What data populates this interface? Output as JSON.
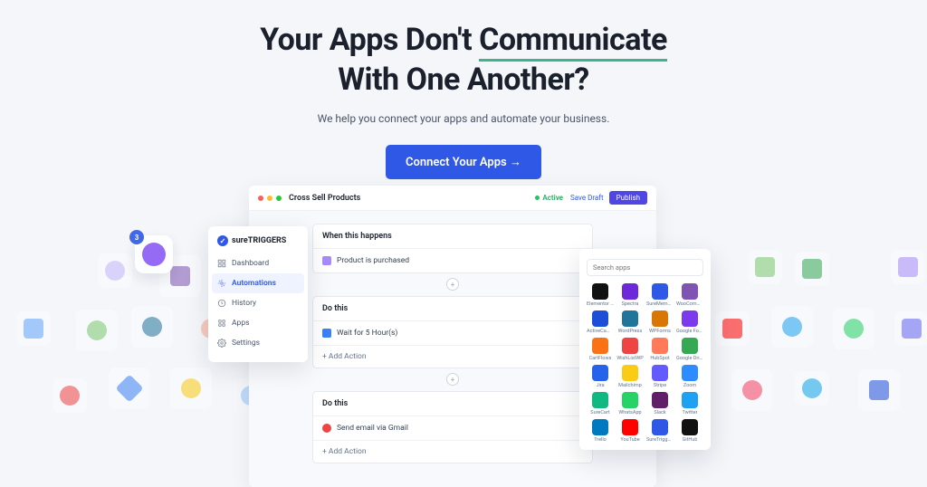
{
  "hero": {
    "headline_pre": "Your Apps Don't ",
    "headline_word": "Communicate",
    "headline_post": "With One Another?",
    "subhead": "We help you connect your apps and automate your business.",
    "cta": "Connect Your Apps →"
  },
  "builder": {
    "title": "Cross Sell Products",
    "status": "Active",
    "save_draft": "Save Draft",
    "publish": "Publish",
    "trigger_head": "When this happens",
    "trigger_row": "Product is purchased",
    "action1_head": "Do this",
    "action1_row": "Wait for 5 Hour(s)",
    "action2_head": "Do this",
    "action2_row": "Send email via Gmail",
    "add_action": "+   Add Action"
  },
  "sidebar": {
    "brand": "sureTRIGGERS",
    "items": [
      "Dashboard",
      "Automations",
      "History",
      "Apps",
      "Settings"
    ]
  },
  "picker": {
    "search_placeholder": "Search apps",
    "apps": [
      {
        "label": "Elementor Pro",
        "color": "#111"
      },
      {
        "label": "Spectra",
        "color": "#6d28d9"
      },
      {
        "label": "SureMembers",
        "color": "#2f58e6"
      },
      {
        "label": "WooCommerce",
        "color": "#7f54b3"
      },
      {
        "label": "ActiveCampaign",
        "color": "#1d4ed8"
      },
      {
        "label": "WordPress",
        "color": "#21759b"
      },
      {
        "label": "WPForms",
        "color": "#d97706"
      },
      {
        "label": "Google Forms",
        "color": "#7c3aed"
      },
      {
        "label": "CartFlows",
        "color": "#f97316"
      },
      {
        "label": "WishListWP",
        "color": "#ef4444"
      },
      {
        "label": "HubSpot",
        "color": "#ff7a59"
      },
      {
        "label": "Google Drive",
        "color": "#34a853"
      },
      {
        "label": "Jira",
        "color": "#2563eb"
      },
      {
        "label": "Mailchimp",
        "color": "#facc15"
      },
      {
        "label": "Stripe",
        "color": "#635bff"
      },
      {
        "label": "Zoom",
        "color": "#2d8cff"
      },
      {
        "label": "SureCart",
        "color": "#10b981"
      },
      {
        "label": "WhatsApp",
        "color": "#25d366"
      },
      {
        "label": "Slack",
        "color": "#611f69"
      },
      {
        "label": "Twitter",
        "color": "#1da1f2"
      },
      {
        "label": "Trello",
        "color": "#0079bf"
      },
      {
        "label": "YouTube",
        "color": "#ff0000"
      },
      {
        "label": "SureTriggers",
        "color": "#2f58e6"
      },
      {
        "label": "GitHub",
        "color": "#111"
      }
    ]
  },
  "floating_badge": {
    "count": "3"
  }
}
